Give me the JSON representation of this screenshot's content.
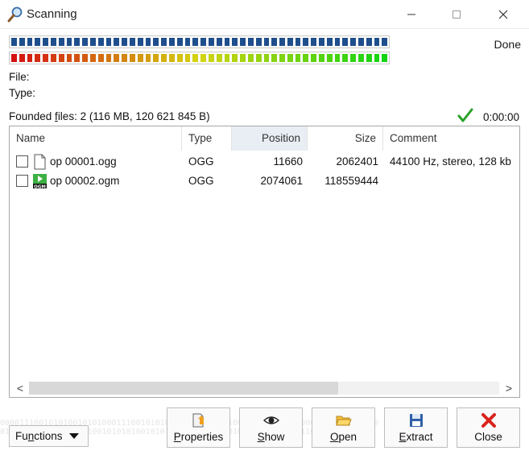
{
  "window": {
    "title": "Scanning",
    "controls": {
      "minimize": "–",
      "maximize": "□",
      "close": "✕"
    }
  },
  "progress": {
    "done_label": "Done",
    "blue_bar_fill": 1.0,
    "color_bar_fill": 1.0
  },
  "fields": {
    "file_label": "File:",
    "type_label": "Type:"
  },
  "summary": {
    "founded_prefix": "Founded ",
    "founded_accel": "f",
    "founded_rest": "iles: 2 (116 MB, 120 621 845 B)",
    "elapsed": "0:00:00"
  },
  "table": {
    "columns": [
      "Name",
      "Type",
      "Position",
      "Size",
      "Comment"
    ],
    "rows": [
      {
        "name": "op 00001.ogg",
        "type": "OGG",
        "position": "11660",
        "size": "2062401",
        "comment": "44100 Hz, stereo, 128 kb",
        "icon": "document-icon",
        "checked": false
      },
      {
        "name": "op 00002.ogm",
        "type": "OGG",
        "position": "2074061",
        "size": "118559444",
        "comment": "",
        "icon": "ogm-video-icon",
        "checked": false
      }
    ]
  },
  "scrollbar": {
    "left_arrow": "<",
    "right_arrow": ">"
  },
  "background_pattern": "000011100101010010101000111001010101001010000111001010100101010001110010101010\n0101010010101000111001010101001010100101010100101010010101000111001010101",
  "buttons": {
    "functions_accel": "n",
    "functions_prefix": "Fu",
    "functions_rest": "ctions",
    "properties_accel": "P",
    "properties_rest": "roperties",
    "show_accel": "S",
    "show_rest": "how",
    "open_accel": "O",
    "open_rest": "pen",
    "extract_accel": "E",
    "extract_rest": "xtract",
    "close_label": "Close"
  },
  "colors": {
    "blue_segment": "#1f4e8c",
    "check_green": "#2aa12a",
    "close_red": "#d9231c"
  }
}
